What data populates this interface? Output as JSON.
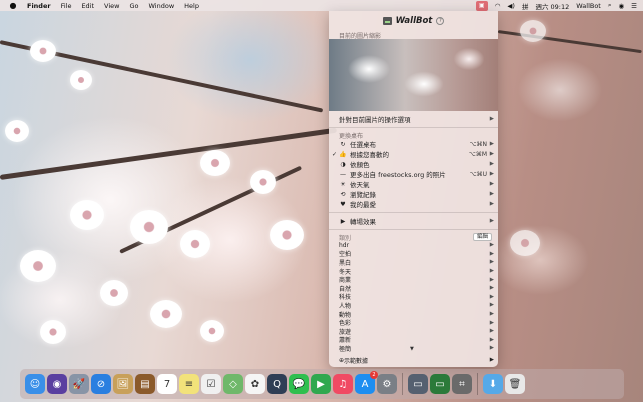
{
  "menubar": {
    "apple": "",
    "app_name": "Finder",
    "menus": [
      "File",
      "Edit",
      "View",
      "Go",
      "Window",
      "Help"
    ],
    "status": {
      "clock": "週六 09:12",
      "app_label": "WallBot"
    }
  },
  "panel": {
    "title": "WallBot",
    "help": "?",
    "current_caption": "目前的圖片縮影",
    "current_options": "針對目前圖片的操作選項",
    "change_caption": "更換桌布",
    "items": [
      {
        "label": "任選桌布",
        "shortcut": "⌥⌘N",
        "checked": false,
        "icon": "↻"
      },
      {
        "label": "根據您喜歡的",
        "shortcut": "⌥⌘M",
        "checked": true,
        "icon": "👍"
      },
      {
        "label": "依顏色",
        "shortcut": "",
        "checked": false,
        "icon": "◑"
      },
      {
        "label": "更多出自 freestocks.org 的照片",
        "shortcut": "⌥⌘U",
        "checked": false,
        "icon": "—"
      },
      {
        "label": "依天氣",
        "shortcut": "",
        "checked": false,
        "icon": "☀"
      },
      {
        "label": "瀏覽紀錄",
        "shortcut": "",
        "checked": false,
        "icon": "⟲"
      },
      {
        "label": "我的最愛",
        "shortcut": "",
        "checked": false,
        "icon": "♥"
      }
    ],
    "transition": "轉場效果",
    "categories_caption": "類別",
    "edit_button": "編輯",
    "categories": [
      "hdr",
      "空拍",
      "黑白",
      "冬天",
      "商業",
      "自然",
      "科技",
      "人物",
      "動物",
      "色彩",
      "旅遊",
      "蕭新",
      "極簡"
    ],
    "more_label": "示範數據"
  },
  "dock": {
    "apps": [
      {
        "name": "finder",
        "color": "#3a8fe8",
        "glyph": "☺"
      },
      {
        "name": "siri",
        "color": "#5a3fa0",
        "glyph": "◉"
      },
      {
        "name": "launchpad",
        "color": "#8894a6",
        "glyph": "🚀"
      },
      {
        "name": "safari",
        "color": "#2a7fe0",
        "glyph": "⊘"
      },
      {
        "name": "photo-slideshow",
        "color": "#c8a05a",
        "glyph": "🖼"
      },
      {
        "name": "notebook",
        "color": "#8b5a2b",
        "glyph": "▤"
      },
      {
        "name": "calendar",
        "color": "#ffffff",
        "glyph": "7"
      },
      {
        "name": "notes",
        "color": "#f2e27a",
        "glyph": "≡"
      },
      {
        "name": "reminders",
        "color": "#f0f0f0",
        "glyph": "☑"
      },
      {
        "name": "maps",
        "color": "#6fb86a",
        "glyph": "◇"
      },
      {
        "name": "photos",
        "color": "#f5f5f5",
        "glyph": "✿"
      },
      {
        "name": "quicktime",
        "color": "#2f3e55",
        "glyph": "Q"
      },
      {
        "name": "messages",
        "color": "#2fbf4f",
        "glyph": "💬"
      },
      {
        "name": "facetime",
        "color": "#2fa84f",
        "glyph": "▶"
      },
      {
        "name": "music",
        "color": "#f04a63",
        "glyph": "♫"
      },
      {
        "name": "app-store",
        "color": "#1e8ef0",
        "glyph": "A",
        "badge": "2"
      },
      {
        "name": "system-preferences",
        "color": "#7a7f86",
        "glyph": "⚙"
      },
      {
        "name": "image-capture",
        "color": "#556070",
        "glyph": "▭"
      },
      {
        "name": "monitor",
        "color": "#2b7a3a",
        "glyph": "▭"
      },
      {
        "name": "scanner",
        "color": "#6a6a6a",
        "glyph": "⌗"
      },
      {
        "name": "downloads-folder",
        "color": "#55a9e8",
        "glyph": "⬇"
      },
      {
        "name": "trash",
        "color": "#e8e8e8",
        "glyph": "🗑"
      }
    ]
  }
}
